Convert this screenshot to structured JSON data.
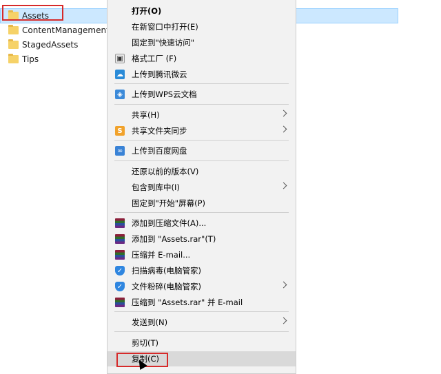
{
  "files": [
    {
      "name": "Assets",
      "selected": true
    },
    {
      "name": "ContentManagementS",
      "selected": false
    },
    {
      "name": "StagedAssets",
      "selected": false
    },
    {
      "name": "Tips",
      "selected": false
    }
  ],
  "menu": {
    "items": [
      {
        "label": "打开(O)",
        "bold": true,
        "icon": "",
        "submenu": false
      },
      {
        "label": "在新窗口中打开(E)",
        "icon": "",
        "submenu": false
      },
      {
        "label": "固定到\"快速访问\"",
        "icon": "",
        "submenu": false
      },
      {
        "label": "格式工厂 (F)",
        "icon": "format-factory-icon",
        "submenu": false
      },
      {
        "label": "上传到腾讯微云",
        "icon": "weiyun-cloud-icon",
        "submenu": false
      },
      {
        "label": "上传到WPS云文档",
        "icon": "wps-cloud-icon",
        "submenu": false
      },
      {
        "label": "共享(H)",
        "icon": "",
        "submenu": true
      },
      {
        "label": "共享文件夹同步",
        "icon": "share-sync-icon",
        "submenu": true
      },
      {
        "label": "上传到百度网盘",
        "icon": "baidu-netdisk-icon",
        "submenu": false
      },
      {
        "label": "还原以前的版本(V)",
        "icon": "",
        "submenu": false
      },
      {
        "label": "包含到库中(I)",
        "icon": "",
        "submenu": true
      },
      {
        "label": "固定到\"开始\"屏幕(P)",
        "icon": "",
        "submenu": false
      },
      {
        "label": "添加到压缩文件(A)...",
        "icon": "winrar-icon",
        "submenu": false
      },
      {
        "label": "添加到 \"Assets.rar\"(T)",
        "icon": "winrar-icon",
        "submenu": false
      },
      {
        "label": "压缩并 E-mail...",
        "icon": "winrar-icon",
        "submenu": false
      },
      {
        "label": "扫描病毒(电脑管家)",
        "icon": "pc-manager-shield-icon",
        "submenu": false
      },
      {
        "label": "文件粉碎(电脑管家)",
        "icon": "pc-manager-shield-icon",
        "submenu": true
      },
      {
        "label": "压缩到 \"Assets.rar\" 并 E-mail",
        "icon": "winrar-icon",
        "submenu": false
      },
      {
        "label": "发送到(N)",
        "icon": "",
        "submenu": true
      },
      {
        "label": "剪切(T)",
        "icon": "",
        "submenu": false
      },
      {
        "label": "复制(C)",
        "icon": "",
        "submenu": false,
        "hover": true
      }
    ]
  },
  "colors": {
    "highlight": "#d62a2a",
    "selection": "#cce8ff",
    "menu_bg": "#f2f2f2"
  }
}
